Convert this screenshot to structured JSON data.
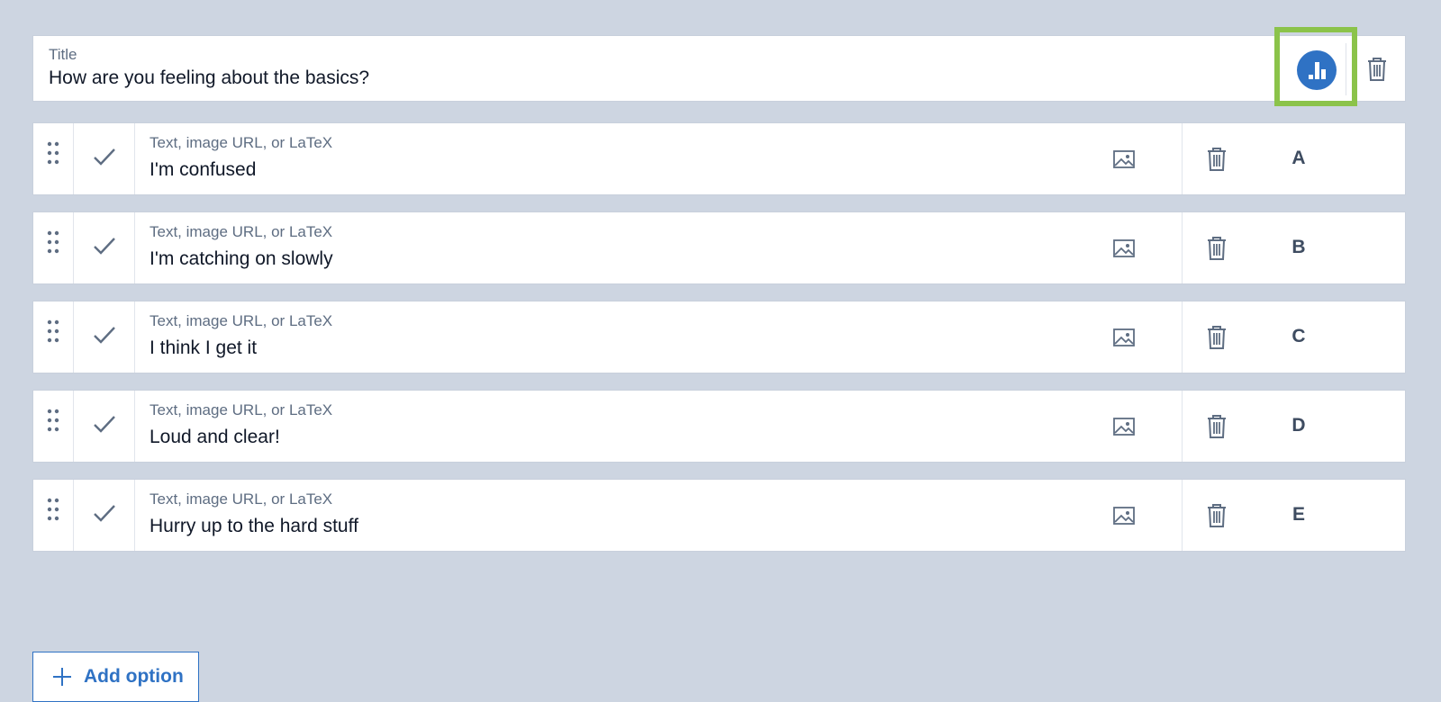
{
  "title": {
    "label": "Title",
    "value": "How are you feeling about the basics?"
  },
  "options": [
    {
      "label": "Text, image URL, or LaTeX",
      "value": "I'm confused",
      "letter": "A"
    },
    {
      "label": "Text, image URL, or LaTeX",
      "value": "I'm catching on slowly",
      "letter": "B"
    },
    {
      "label": "Text, image URL, or LaTeX",
      "value": "I think I get it",
      "letter": "C"
    },
    {
      "label": "Text, image URL, or LaTeX",
      "value": "Loud and clear!",
      "letter": "D"
    },
    {
      "label": "Text, image URL, or LaTeX",
      "value": "Hurry up to the hard stuff",
      "letter": "E"
    }
  ],
  "add_option": {
    "label": "Add option"
  },
  "icons": {
    "poll": "poll-chart-icon",
    "trash": "trash-icon",
    "drag": "drag-handle-icon",
    "check": "check-icon",
    "image": "image-icon",
    "plus": "plus-icon"
  },
  "colors": {
    "background": "#cdd5e1",
    "accent": "#2f72c4",
    "highlight": "#8bc34a",
    "muted_text": "#5e6d82"
  }
}
